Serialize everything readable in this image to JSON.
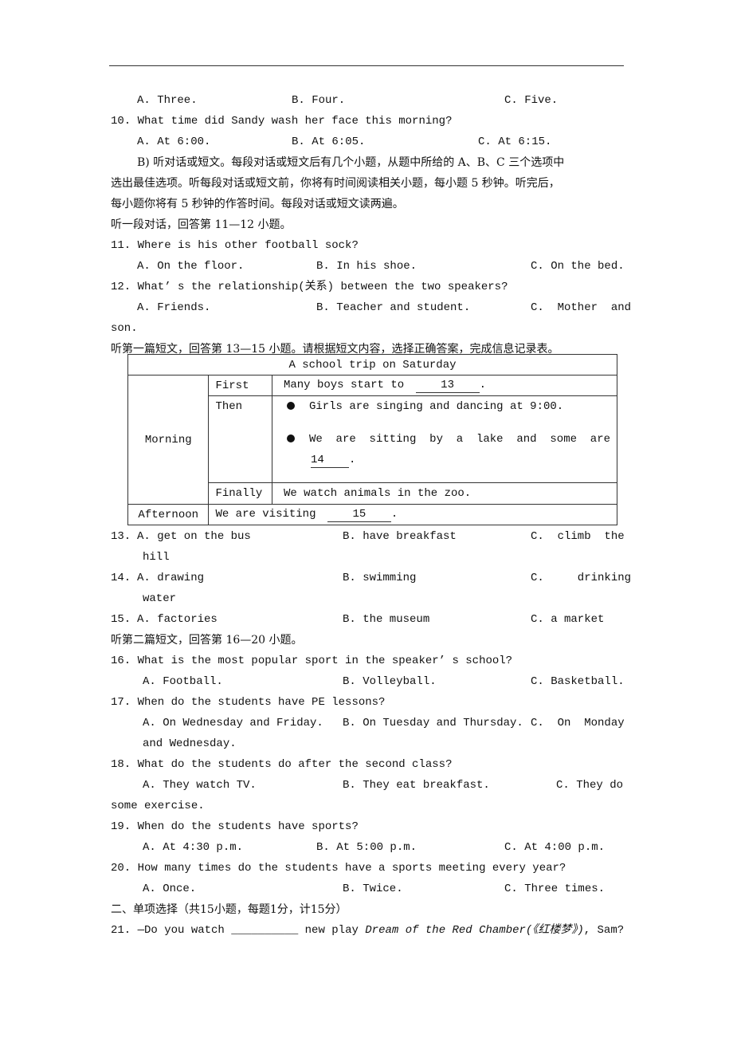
{
  "q9_options": [
    "A. Three.",
    "B. Four.",
    "C. Five."
  ],
  "q10": {
    "stem": "10. What time did Sandy wash her face this morning?",
    "options": [
      "A. At 6:00.",
      "B. At 6:05.",
      "C. At 6:15."
    ]
  },
  "sectionB_instructions": [
    "B) 听对话或短文。每段对话或短文后有几个小题，从题中所给的 A、B、C 三个选项中",
    "选出最佳选项。听每段对话或短文前，你将有时间阅读相关小题，每小题 5 秒钟。听完后，",
    "每小题你将有 5 秒钟的作答时间。每段对话或短文读两遍。"
  ],
  "dialogue_intro": "听一段对话，回答第 11—12 小题。",
  "q11": {
    "stem": "11. Where is his other football sock?",
    "options": [
      "A. On the floor.",
      "B. In his shoe.",
      "C. On the bed."
    ]
  },
  "q12": {
    "stem": "12. What’ s the relationship(关系) between the two speakers?",
    "options": [
      "A. Friends.",
      "B. Teacher and student.",
      "C.  Mother  and"
    ],
    "wrap": "son."
  },
  "passage1_intro": "听第一篇短文，回答第 13—15 小题。请根据短文内容，选择正确答案，完成信息记录表。",
  "table": {
    "title": "A school trip on Saturday",
    "morning_label": "Morning",
    "afternoon_label": "Afternoon",
    "first_label": "First",
    "then_label": "Then",
    "finally_label": "Finally",
    "first_text": "Many boys start to",
    "blank13": "13",
    "then_bullet1": "Girls are singing and dancing at 9:00.",
    "then_bullet2": "We  are  sitting  by  a  lake  and  some  are",
    "blank14": "14",
    "finally_text": "We watch animals in the zoo.",
    "afternoon_text": "We are visiting",
    "blank15": "15"
  },
  "q13": {
    "num": "13.",
    "options": [
      "A. get on the bus",
      "B. have breakfast",
      "C.  climb  the"
    ],
    "wrap": "hill"
  },
  "q14": {
    "num": "14.",
    "options": [
      "A. drawing",
      "B. swimming",
      "C.     drinking"
    ],
    "wrap": "water"
  },
  "q15": {
    "num": "15.",
    "options": [
      "A. factories",
      "B. the museum",
      "C. a market"
    ]
  },
  "passage2_intro": "听第二篇短文，回答第 16—20 小题。",
  "q16": {
    "stem": "16. What is the most popular sport in the speaker’ s school?",
    "options": [
      "A. Football.",
      "B. Volleyball.",
      "C. Basketball."
    ]
  },
  "q17": {
    "stem": "17. When do the students have PE lessons?",
    "options": [
      "A. On Wednesday and Friday.",
      "B. On Tuesday and Thursday.",
      "C.  On  Monday"
    ],
    "wrap": "and Wednesday."
  },
  "q18": {
    "stem": "18. What do the students do after the second class?",
    "options": [
      "A. They watch TV.",
      "B. They eat breakfast.",
      "C. They do"
    ],
    "wrap": "some exercise."
  },
  "q19": {
    "stem": "19. When do the students have sports?",
    "options": [
      "A. At 4:30 p.m.",
      "B. At 5:00 p.m.",
      "C. At 4:00 p.m."
    ]
  },
  "q20": {
    "stem": "20. How many times do the students have a sports meeting every year?",
    "options": [
      "A. Once.",
      "B. Twice.",
      "C. Three times."
    ]
  },
  "part2_heading": "二、单项选择（共15小题，每题1分，计15分）",
  "q21": {
    "prefix": "21. —Do you watch",
    "blank": "__________",
    "middle": "new play",
    "title_italic": "Dream of the Red Chamber(《红楼梦》)",
    "suffix": ", Sam?"
  }
}
